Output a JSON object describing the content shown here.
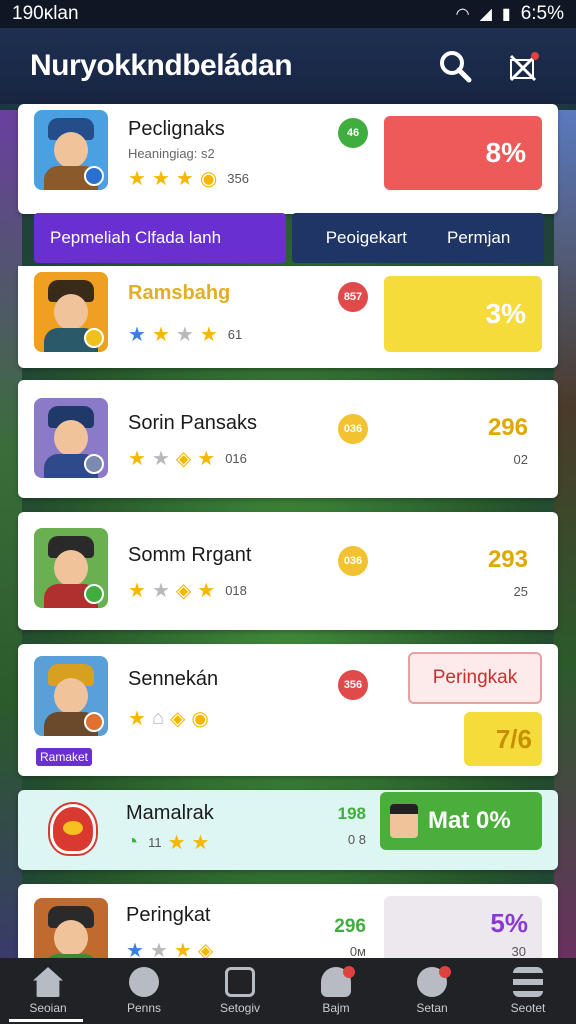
{
  "status_bar": {
    "time_left": "190ĸlan",
    "time_right": "6:5%"
  },
  "app_bar": {
    "title": "Nuryokkndbeládan"
  },
  "colors": {
    "green": "#3fae3f",
    "red": "#e04a4a",
    "yellow": "#f2d530",
    "purple": "#6a2fd0",
    "navy": "#1f3565"
  },
  "items": [
    {
      "name": "Peclignaks",
      "sub": "Heaningiag: s2",
      "star_count": "356",
      "dot": "46",
      "value": "8%"
    },
    {
      "name": "Ramsbahg",
      "star_count": "61",
      "dot": "857",
      "value": "3%"
    },
    {
      "name": "Sorin Pansaks",
      "star_count": "016",
      "dot": "036",
      "value": "296",
      "value_sub": "02"
    },
    {
      "name": "Somm Rrgant",
      "star_count": "018",
      "dot": "036",
      "value": "293",
      "value_sub": "25"
    },
    {
      "name": "Sennekán",
      "tag": "Ramaket",
      "dot": "356",
      "action": "Peringkak",
      "value": "7/6"
    },
    {
      "name": "Mamalrak",
      "star_count": "11",
      "value": "198",
      "value_sub": "0 8",
      "badge": "Mat 0%"
    },
    {
      "name": "Peringkat",
      "value": "296",
      "value_sub": "0м",
      "badge": "5%",
      "badge_sub": "30"
    }
  ],
  "filter_bar": {
    "left_label": "Pepmeliah Clfada lanh",
    "right_label_1": "Peoigekart",
    "right_label_2": "Permjan"
  },
  "bottom_nav": [
    {
      "label": "Seoian"
    },
    {
      "label": "Penns"
    },
    {
      "label": "Setogiv"
    },
    {
      "label": "Bajm"
    },
    {
      "label": "Setan"
    },
    {
      "label": "Seotet"
    }
  ]
}
